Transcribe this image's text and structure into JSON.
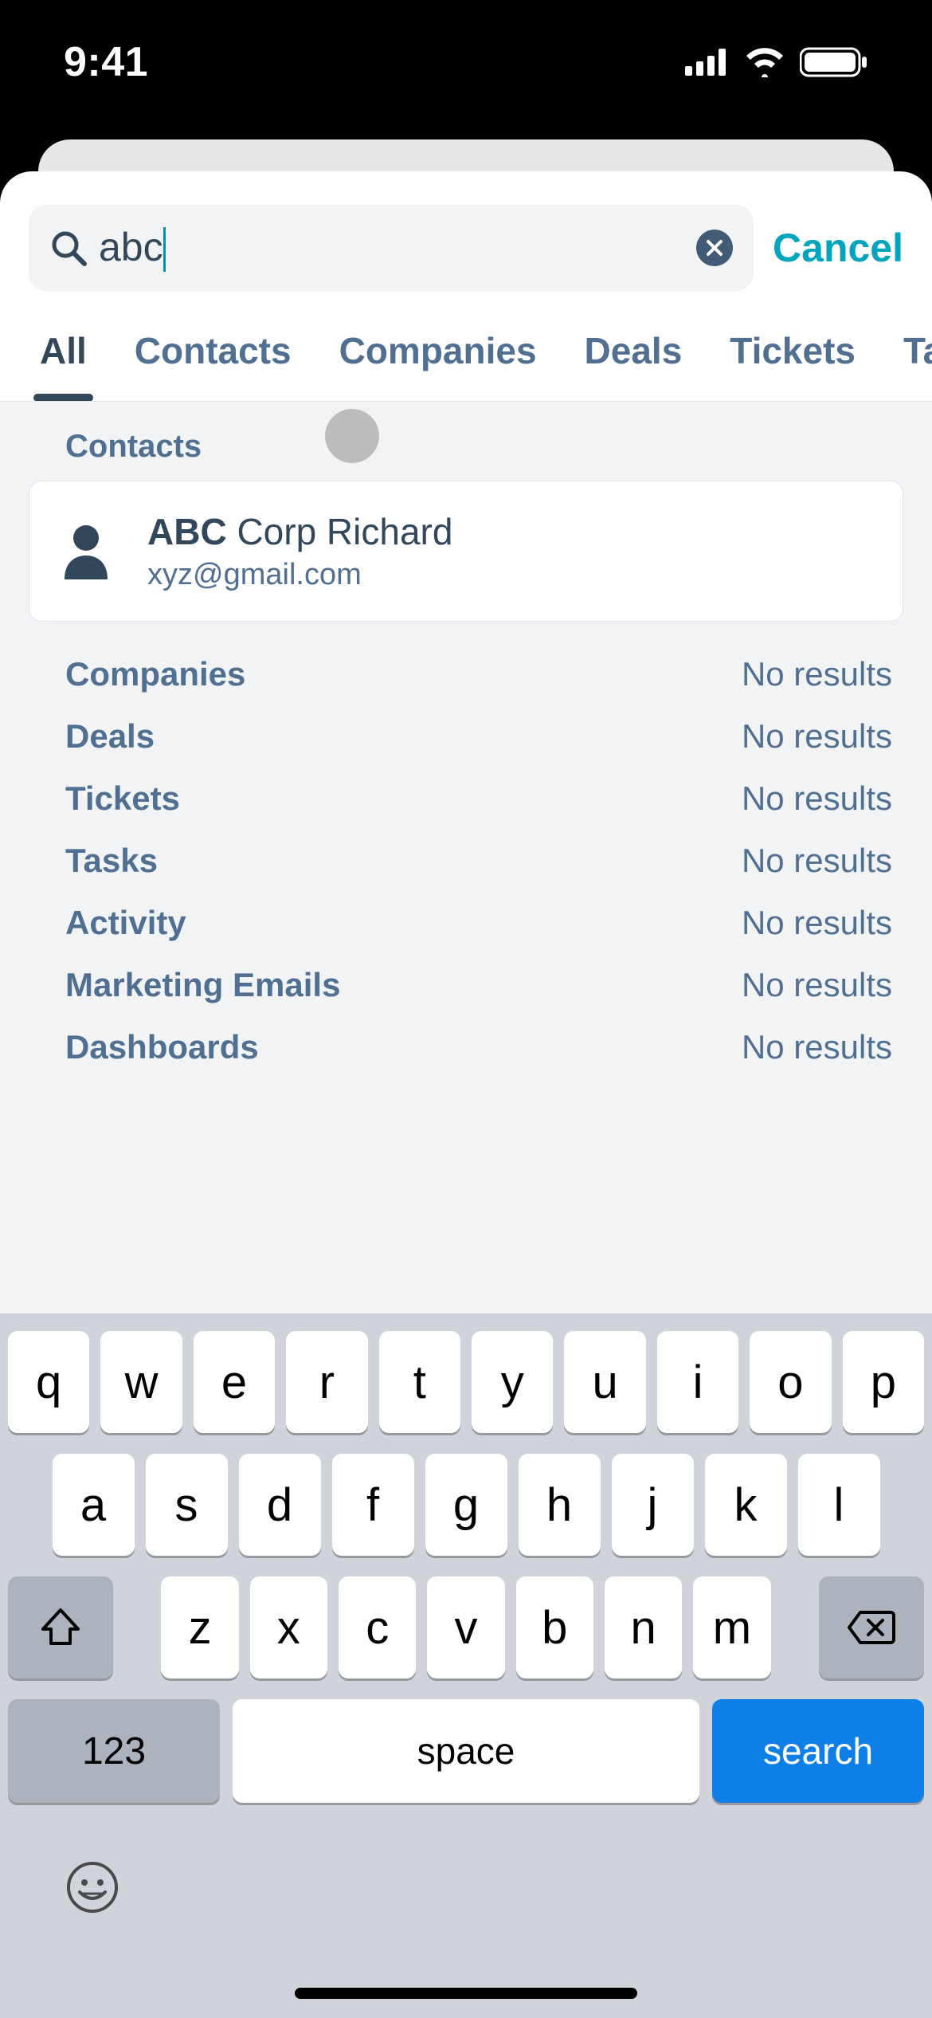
{
  "status": {
    "time": "9:41"
  },
  "search": {
    "value": "abc",
    "cancel": "Cancel"
  },
  "tabs": [
    "All",
    "Contacts",
    "Companies",
    "Deals",
    "Tickets",
    "Tasks"
  ],
  "results": {
    "contacts_header": "Contacts",
    "contact": {
      "match": "ABC",
      "rest": " Corp Richard",
      "email": "xyz@gmail.com"
    },
    "no_results_text": "No results",
    "empty_sections": [
      "Companies",
      "Deals",
      "Tickets",
      "Tasks",
      "Activity",
      "Marketing Emails",
      "Dashboards"
    ]
  },
  "keyboard": {
    "row1": [
      "q",
      "w",
      "e",
      "r",
      "t",
      "y",
      "u",
      "i",
      "o",
      "p"
    ],
    "row2": [
      "a",
      "s",
      "d",
      "f",
      "g",
      "h",
      "j",
      "k",
      "l"
    ],
    "row3": [
      "z",
      "x",
      "c",
      "v",
      "b",
      "n",
      "m"
    ],
    "numeric": "123",
    "space": "space",
    "action": "search"
  }
}
